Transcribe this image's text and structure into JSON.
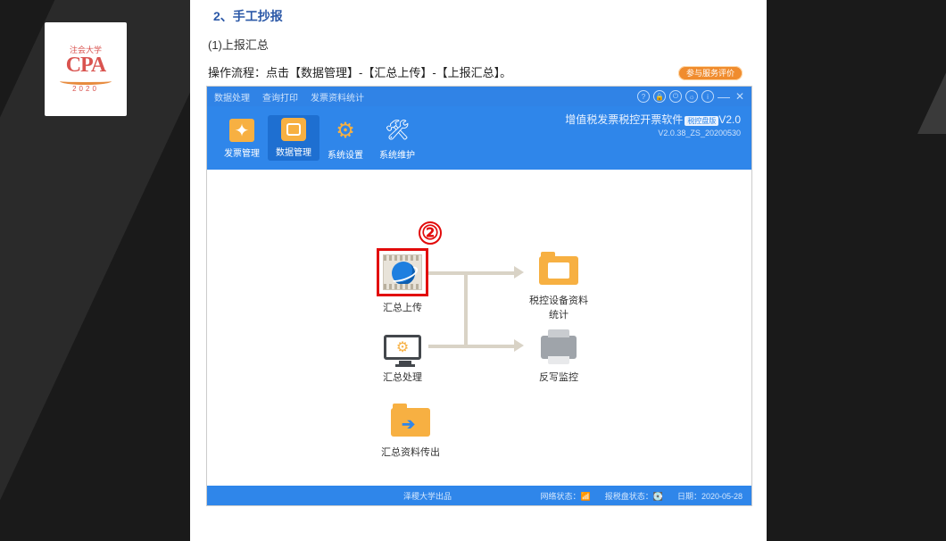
{
  "document": {
    "section_title": "2、手工抄报",
    "subsection": "(1)上报汇总",
    "process_line": "操作流程：点击【数据管理】-【汇总上传】-【上报汇总】。"
  },
  "logo": {
    "top_text": "注会大学",
    "main": "CPA",
    "year": "2020"
  },
  "app": {
    "menus": {
      "m1": "数据处理",
      "m2": "查询打印",
      "m3": "发票资料统计"
    },
    "service_button": "参与服务评价",
    "ribbon": {
      "btn1": "发票管理",
      "btn2": "数据管理",
      "btn3": "系统设置",
      "btn4": "系统维护"
    },
    "title": {
      "line1": "增值税发票税控开票软件",
      "edition_pill": "税控盘版",
      "version_suffix": "V2.0",
      "line2": "V2.0.38_ZS_20200530"
    },
    "flow": {
      "annot_num": "②",
      "upload": "汇总上传",
      "device_stat": "税控设备资料\n统计",
      "process": "汇总处理",
      "rewrite": "反写监控",
      "export": "汇总资料传出"
    },
    "status": {
      "brand": "泽稷大学出品",
      "net_label": "网络状态：",
      "disk_label": "报税盘状态：",
      "date_label": "日期：",
      "date_value": "2020-05-28"
    }
  }
}
